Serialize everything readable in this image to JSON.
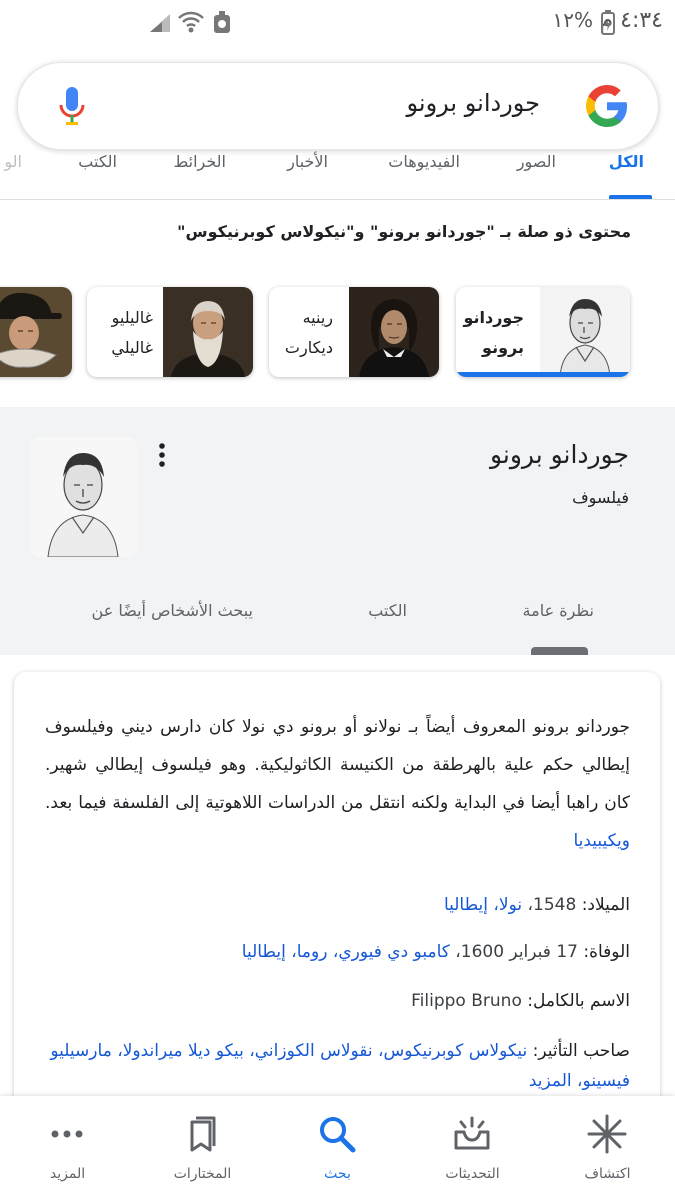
{
  "status_bar": {
    "time": "٤:٣٤ م",
    "battery": "١٢%"
  },
  "search": {
    "query": "جوردانو برونو"
  },
  "tabs": [
    {
      "label": "الكل"
    },
    {
      "label": "الصور"
    },
    {
      "label": "الفيديوهات"
    },
    {
      "label": "الأخبار"
    },
    {
      "label": "الخرائط"
    },
    {
      "label": "الكتب"
    },
    {
      "label": "الو"
    }
  ],
  "related": {
    "title": "محتوى ذو صلة بـ \"جوردانو برونو\" و\"نيكولاس كوبرنيكوس\"",
    "cards": [
      {
        "line1": "جوردانو",
        "line2": "برونو"
      },
      {
        "line1": "رينيه",
        "line2": "ديكارت"
      },
      {
        "line1": "غاليليو",
        "line2": "غاليلي"
      }
    ]
  },
  "panel": {
    "title": "جوردانو برونو",
    "subtitle": "فيلسوف",
    "tabs": [
      {
        "label": "نظرة عامة"
      },
      {
        "label": "الكتب"
      },
      {
        "label": "يبحث الأشخاص أيضًا عن"
      }
    ]
  },
  "description": {
    "text": "جوردانو برونو المعروف أيضاً بـ نولانو أو برونو دي نولا كان دارس ديني وفيلسوف إيطالي حكم علية بالهرطقة من الكنيسة الكاثوليكية. وهو فيلسوف إيطالي شهير. كان راهبا أيضا في البداية ولكنه انتقل من الدراسات اللاهوتية إلى الفلسفة فيما بعد.",
    "source": "ويكيبيديا"
  },
  "facts": {
    "birth": {
      "key": "الميلاد:",
      "year": "1548،",
      "place": "نولا، إيطاليا"
    },
    "death": {
      "key": "الوفاة:",
      "date": "17 فبراير 1600،",
      "place": "كامبو دي فيوري، روما، إيطاليا"
    },
    "fullname": {
      "key": "الاسم بالكامل:",
      "value": "Filippo Bruno"
    },
    "influence": {
      "key": "صاحب التأثير:",
      "value": "نيكولاس كوبرنيكوس، نقولاس الكوزاني، بيكو ديلا ميراندولا، مارسيليو فيسينو،",
      "more": "المزيد"
    }
  },
  "bottom_nav": [
    {
      "label": "اكتشاف",
      "icon": "asterisk-icon"
    },
    {
      "label": "التحديثات",
      "icon": "updates-tray-icon"
    },
    {
      "label": "بحث",
      "icon": "search-icon"
    },
    {
      "label": "المختارات",
      "icon": "bookmarks-icon"
    },
    {
      "label": "المزيد",
      "icon": "more-dots-icon"
    }
  ],
  "colors": {
    "accent": "#1a73e8",
    "link": "#1558d6",
    "panel_bg": "#f1f3f4"
  }
}
